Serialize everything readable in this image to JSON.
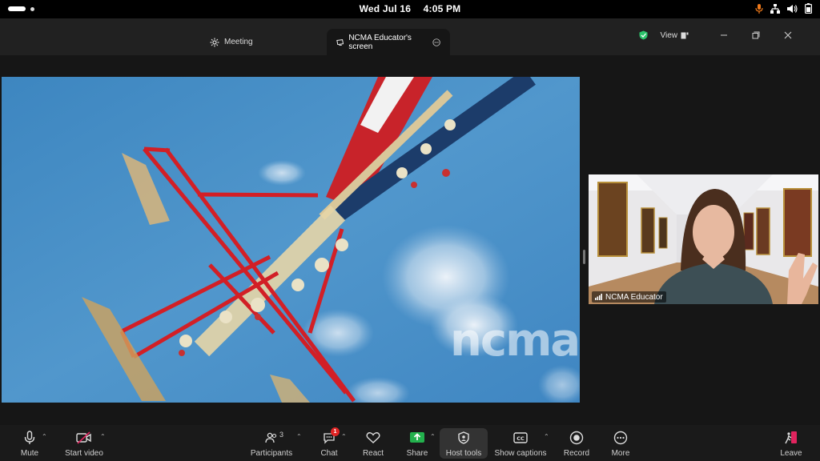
{
  "os": {
    "date": "Wed Jul 16",
    "time": "4:05 PM"
  },
  "tabs": {
    "meeting": "Meeting",
    "share": "NCMA Educator's screen"
  },
  "header": {
    "view_label": "View"
  },
  "video": {
    "watermark": "ncma",
    "participant_name": "NCMA Educator"
  },
  "toolbar": {
    "mute": "Mute",
    "start_video": "Start video",
    "participants": "Participants",
    "participants_count": "3",
    "chat": "Chat",
    "chat_badge": "1",
    "react": "React",
    "share": "Share",
    "host_tools": "Host tools",
    "show_captions": "Show captions",
    "record": "Record",
    "more": "More",
    "leave": "Leave"
  },
  "colors": {
    "share_green": "#23b14d",
    "leave_red": "#e0245e",
    "badge_red": "#e02424",
    "shield_green": "#2cc36b",
    "mic_orange": "#f07a1a"
  }
}
